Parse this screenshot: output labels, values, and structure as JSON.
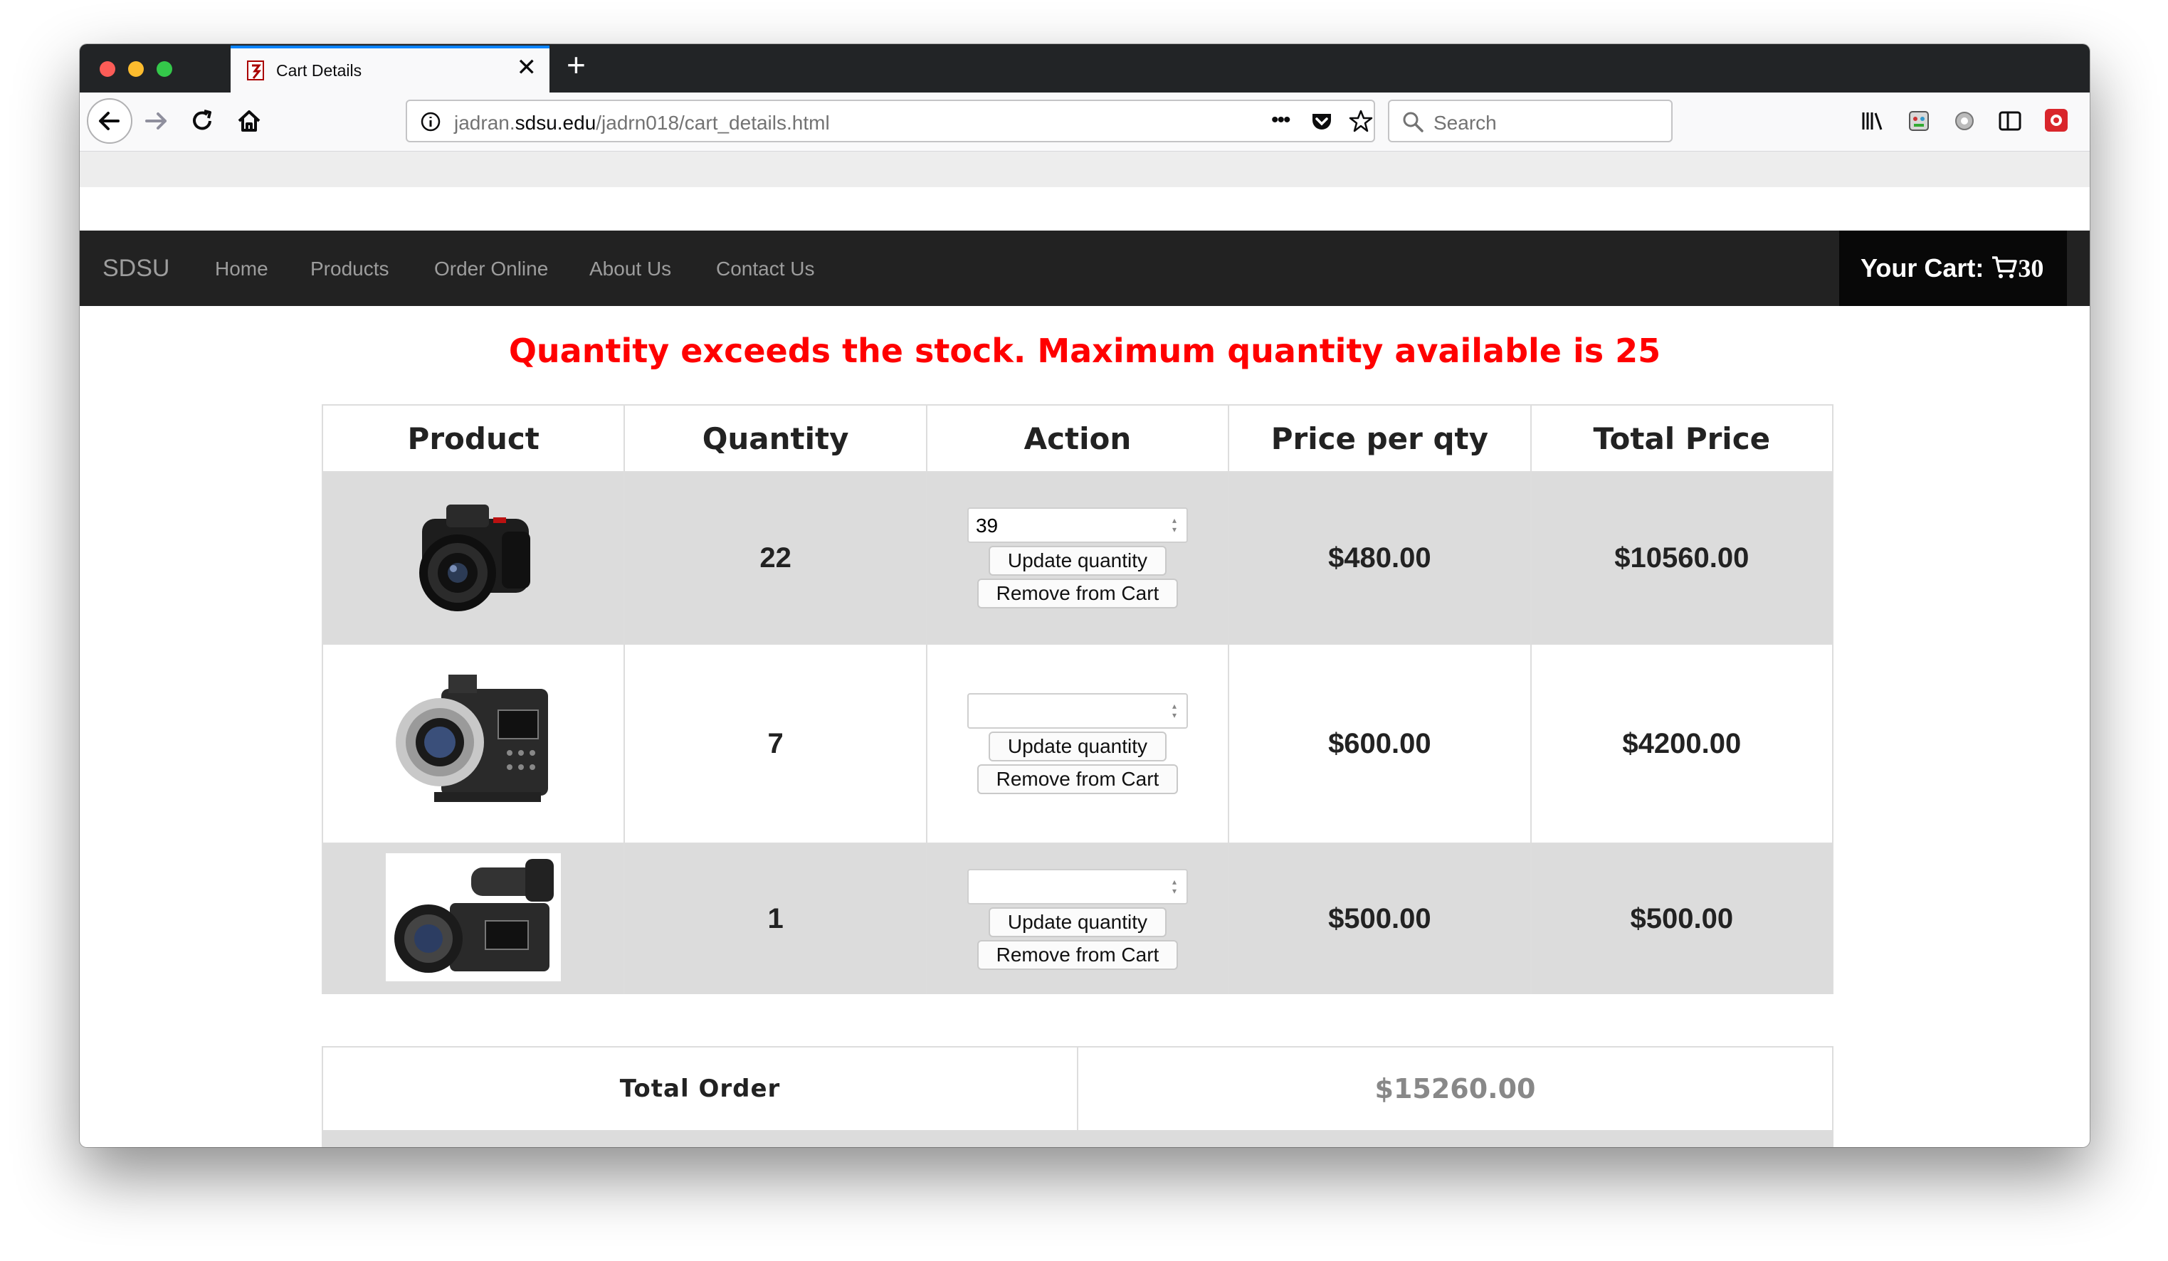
{
  "browser": {
    "tab_title": "Cart Details",
    "tab_close": "✕",
    "new_tab": "+",
    "url_prefix": "jadran.",
    "url_domain": "sdsu.edu",
    "url_path": "/jadrn018/cart_details.html",
    "url_more": "•••",
    "search_placeholder": "Search"
  },
  "navbar": {
    "brand": "SDSU",
    "links": [
      "Home",
      "Products",
      "Order Online",
      "About Us",
      "Contact Us"
    ],
    "cart_label": "Your Cart:",
    "cart_count": "30"
  },
  "error_message": "Quantity exceeds the stock. Maximum quantity available is 25",
  "table": {
    "headers": [
      "Product",
      "Quantity",
      "Action",
      "Price per qty",
      "Total Price"
    ],
    "rows": [
      {
        "product": "dslr-camera",
        "quantity": "22",
        "input_value": "39",
        "update_label": "Update quantity",
        "remove_label": "Remove from Cart",
        "price": "$480.00",
        "total": "$10560.00"
      },
      {
        "product": "cinema-camera",
        "quantity": "7",
        "input_value": "",
        "update_label": "Update quantity",
        "remove_label": "Remove from Cart",
        "price": "$600.00",
        "total": "$4200.00"
      },
      {
        "product": "camcorder",
        "quantity": "1",
        "input_value": "",
        "update_label": "Update quantity",
        "remove_label": "Remove from Cart",
        "price": "$500.00",
        "total": "$500.00"
      }
    ]
  },
  "total": {
    "label": "Total Order",
    "value": "$15260.00"
  },
  "colors": {
    "error": "#ff0000",
    "navbar_bg": "#222222",
    "row_alt": "#dcdcdc",
    "tab_accent": "#0a84ff"
  }
}
